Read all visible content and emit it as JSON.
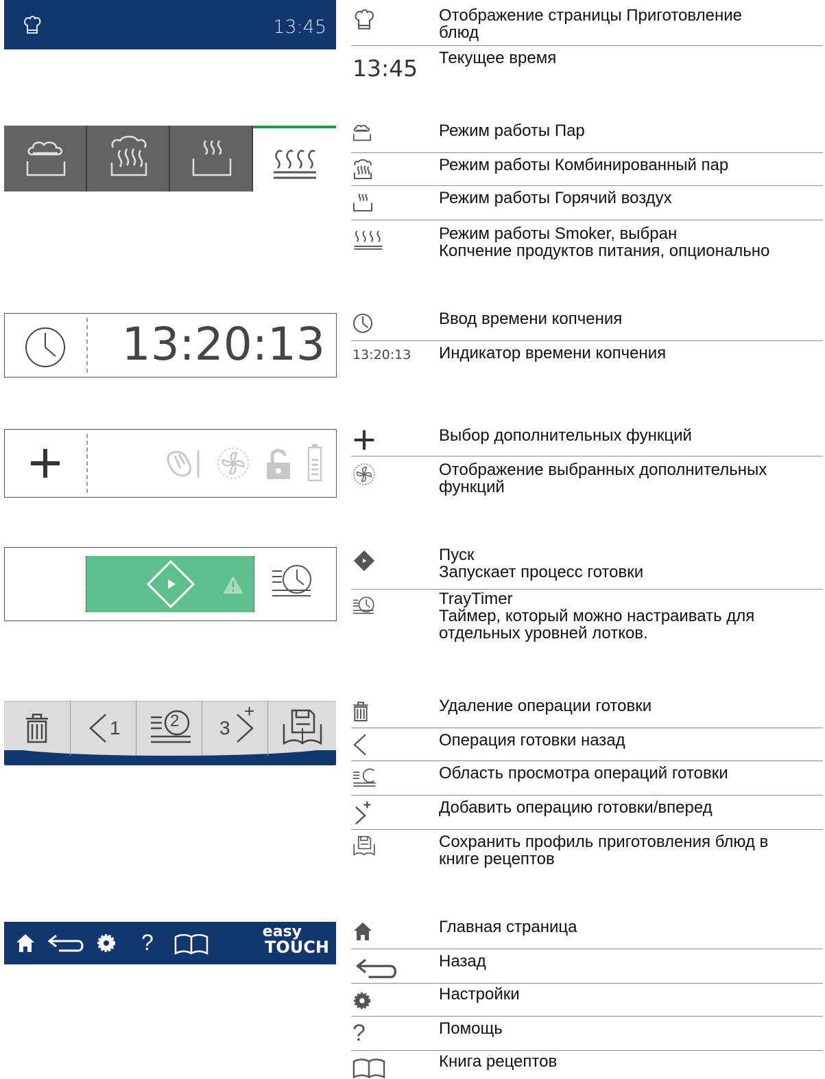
{
  "colors": {
    "header_blue": "#12376e",
    "mode_grey": "#636363",
    "selected_green": "#1e9a4a",
    "start_green": "#5fbf8c"
  },
  "left": {
    "header": {
      "time": "13:45",
      "icon": "chef-hat-icon"
    },
    "modes": [
      {
        "icon": "steam-icon",
        "selected": false
      },
      {
        "icon": "combi-steam-icon",
        "selected": false
      },
      {
        "icon": "hot-air-icon",
        "selected": false
      },
      {
        "icon": "smoker-icon",
        "selected": true
      }
    ],
    "smoke_timer": {
      "icon": "clock-icon",
      "value": "13:20:13"
    },
    "extras": {
      "add_icon": "plus-icon",
      "icons": [
        "climate-icon",
        "fan-icon",
        "lock-icon",
        "battery-icon"
      ]
    },
    "start": {
      "icons": [
        "start-diamond-icon",
        "warning-icon",
        "traytimer-icon"
      ]
    },
    "steps": {
      "back_number": "1",
      "current_number": "2",
      "next_number": "3",
      "plus": "+"
    },
    "nav": {
      "logo_top": "easy",
      "logo_bottom": "TOUCH"
    }
  },
  "legend": [
    {
      "icon": "chef-hat-icon",
      "text": "Отображение страницы Приготовление\nблюд"
    },
    {
      "icon_text": "13:45",
      "text": "Текущее время"
    },
    {
      "icon": "steam-icon",
      "text": "Режим работы Пар"
    },
    {
      "icon": "combi-steam-icon",
      "text": "Режим работы Комбинированный пар"
    },
    {
      "icon": "hot-air-icon",
      "text": "Режим работы Горячий воздух"
    },
    {
      "icon": "smoker-icon",
      "text": "Режим работы Smoker, выбран\nКопчение продуктов питания, опционально"
    },
    {
      "icon": "clock-icon",
      "text": "Ввод времени копчения"
    },
    {
      "icon_text": "13:20:13",
      "text": "Индикатор времени копчения"
    },
    {
      "icon": "plus-icon",
      "text": "Выбор дополнительных функций"
    },
    {
      "icon": "fan-icon",
      "text": "Отображение выбранных дополнительных\nфункций"
    },
    {
      "icon": "start-diamond-icon",
      "text": "Пуск\nЗапускает процесс готовки"
    },
    {
      "icon": "traytimer-icon",
      "text": "TrayTimer\nТаймер, который можно настраивать для\nотдельных уровней лотков."
    },
    {
      "icon": "trash-icon",
      "text": "Удаление операции готовки"
    },
    {
      "icon": "chevron-left-icon",
      "text": "Операция готовки назад"
    },
    {
      "icon": "steps-view-icon",
      "text": "Область просмотра операций готовки"
    },
    {
      "icon": "chevron-right-plus-icon",
      "text": "Добавить операцию готовки/вперед"
    },
    {
      "icon": "save-book-icon",
      "text": "Сохранить профиль приготовления блюд в\nкниге рецептов"
    },
    {
      "icon": "home-icon",
      "text": "Главная страница"
    },
    {
      "icon": "back-arrow-icon",
      "text": "Назад"
    },
    {
      "icon": "gear-icon",
      "text": "Настройки"
    },
    {
      "icon": "help-icon",
      "text": "Помощь"
    },
    {
      "icon": "book-icon",
      "text": "Книга рецептов"
    }
  ]
}
